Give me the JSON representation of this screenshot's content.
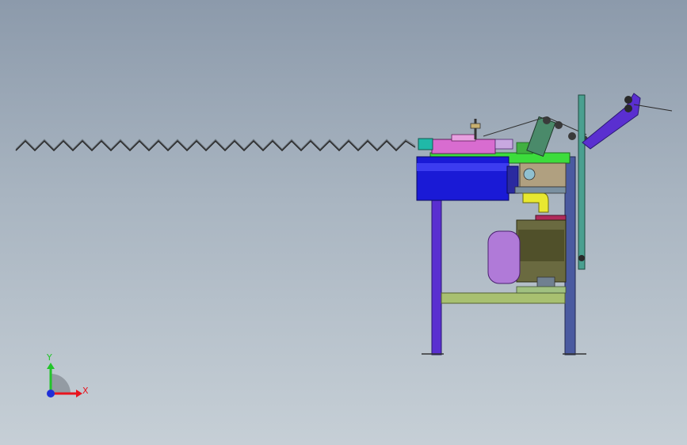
{
  "viewport": {
    "background_top": "#8c9aab",
    "background_bottom": "#c6cfd6"
  },
  "triad": {
    "x_label": "X",
    "y_label": "Y",
    "x_color": "#e8141e",
    "y_color": "#22c42a",
    "z_color": "#1f2fd8"
  },
  "model": {
    "spring_color": "#2a2a2a",
    "frame_color": "#5a2fd0",
    "table_color": "#3cdc3c",
    "blue_drum_color": "#1a1ad6",
    "motor_color": "#b07ad8"
  }
}
